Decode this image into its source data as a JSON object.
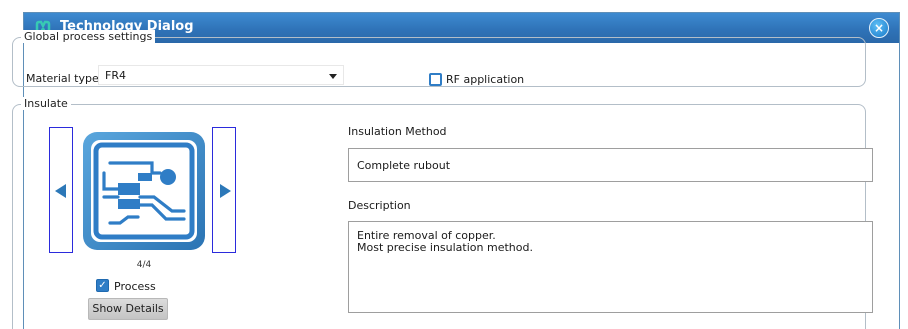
{
  "dialog": {
    "title": "Technology Dialog",
    "close_symbol": "×"
  },
  "global_settings": {
    "group_label": "Global process settings",
    "material_label": "Material type",
    "material_value": "FR4",
    "rf_label": "RF application",
    "rf_checked": false
  },
  "insulate": {
    "group_label": "Insulate",
    "counter": "4/4",
    "process_label": "Process",
    "process_checked": true,
    "show_details_label": "Show Details",
    "method_label": "Insulation Method",
    "method_value": "Complete rubout",
    "description_label": "Description",
    "description_lines": [
      "Entire removal of copper.",
      "Most precise insulation method."
    ]
  },
  "icons": {
    "app": "circuit-app-icon",
    "close": "close-icon",
    "prev": "arrow-left-icon",
    "next": "arrow-right-icon",
    "image": "pcb-rubout-icon",
    "dropdown": "chevron-down-icon",
    "check": "checkmark-icon"
  },
  "colors": {
    "titlebar": "#2f73b8",
    "accent": "#2c78b8",
    "nav_border": "#2b2bdc",
    "close_button": "#1878c8"
  }
}
